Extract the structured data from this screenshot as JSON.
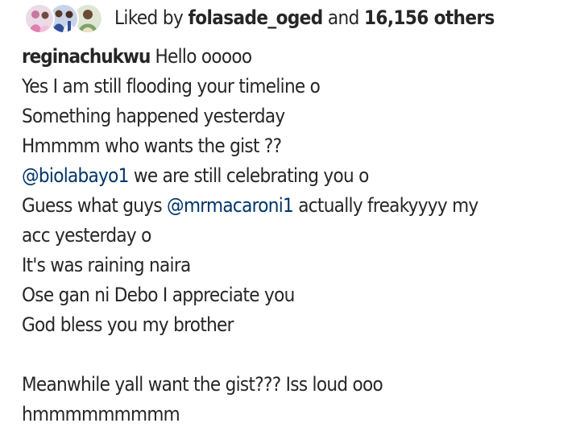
{
  "likes": {
    "prefix": "Liked by",
    "first_user": "folasade_oged",
    "conjunction": "and",
    "count_text": "16,156 others"
  },
  "avatars": [
    {
      "name": "avatar-1",
      "color": "#d9a3c8"
    },
    {
      "name": "avatar-2",
      "color": "#3a5ea8"
    },
    {
      "name": "avatar-3",
      "color": "#7fa36b"
    }
  ],
  "caption": {
    "username": "reginachukwu",
    "lines": [
      "Hello ooooo",
      "Yes I am still flooding your timeline o",
      "Something happened yesterday",
      "Hmmmm who wants the gist ??",
      "",
      "",
      "acc yesterday o",
      "It's was raining naira",
      "Ose gan ni Debo I appreciate you",
      "God bless you my brother",
      "",
      "Meanwhile yall want the gist??? Iss loud ooo",
      "hmmmmmmmmm"
    ],
    "mention1": "@biolabayo1",
    "mention1_rest": " we are still celebrating you o",
    "line6_prefix": "Guess what guys ",
    "mention2": "@mrmacaroni1",
    "mention2_rest": " actually freakyyyy my"
  },
  "colors": {
    "text": "#262626",
    "mention": "#003569"
  }
}
